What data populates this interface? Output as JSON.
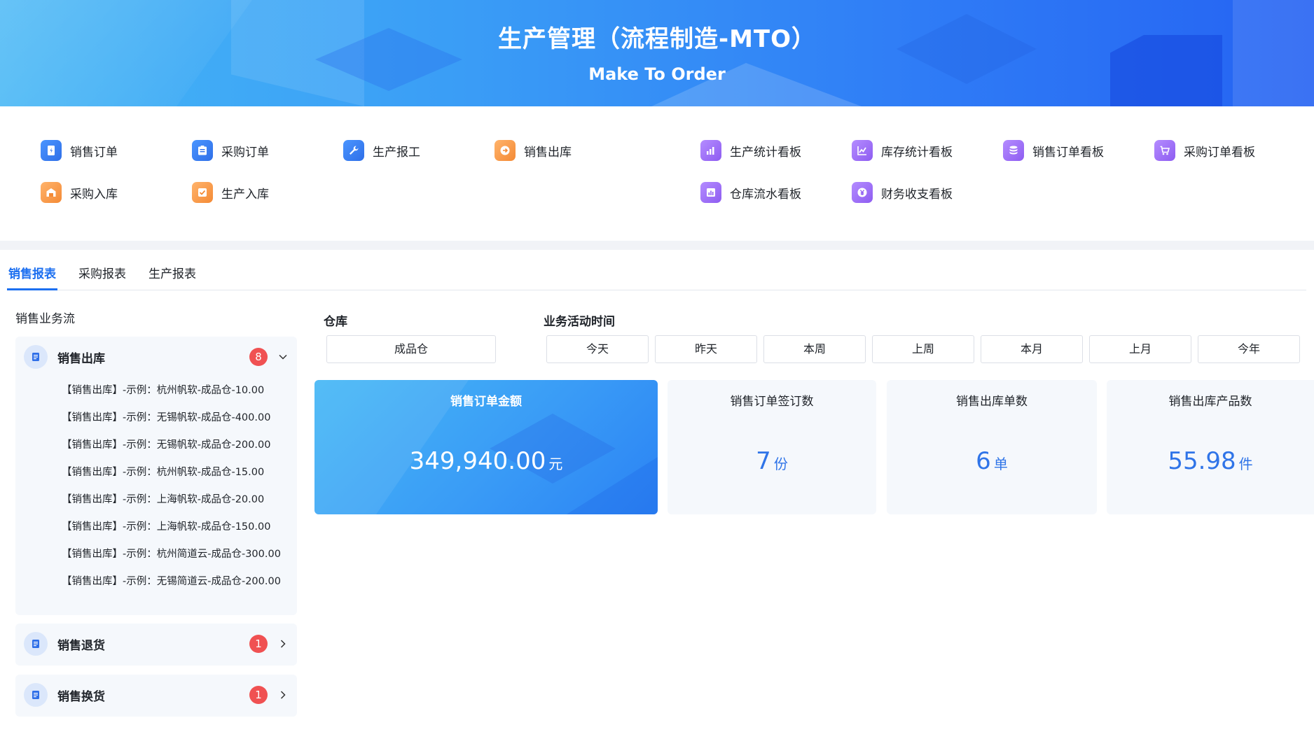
{
  "banner": {
    "title": "生产管理（流程制造-MTO）",
    "subtitle": "Make To Order"
  },
  "quick_links": [
    {
      "label": "销售订单",
      "icon": "sales-order-icon",
      "color": "blue"
    },
    {
      "label": "采购订单",
      "icon": "purchase-order-icon",
      "color": "blue"
    },
    {
      "label": "生产报工",
      "icon": "wrench-icon",
      "color": "blue"
    },
    {
      "label": "销售出库",
      "icon": "arrow-circle-icon",
      "color": "orange"
    },
    {
      "label": "采购入库",
      "icon": "warehouse-in-icon",
      "color": "orange"
    },
    {
      "label": "生产入库",
      "icon": "check-box-icon",
      "color": "orange"
    },
    {
      "label": "生产统计看板",
      "icon": "bar-chart-icon",
      "color": "purple"
    },
    {
      "label": "库存统计看板",
      "icon": "line-chart-icon",
      "color": "purple"
    },
    {
      "label": "销售订单看板",
      "icon": "database-icon",
      "color": "purple"
    },
    {
      "label": "采购订单看板",
      "icon": "cart-icon",
      "color": "purple"
    },
    {
      "label": "仓库流水看板",
      "icon": "bar-board-icon",
      "color": "purple"
    },
    {
      "label": "财务收支看板",
      "icon": "yen-icon",
      "color": "purple"
    }
  ],
  "tabs": [
    {
      "label": "销售报表",
      "active": true
    },
    {
      "label": "采购报表",
      "active": false
    },
    {
      "label": "生产报表",
      "active": false
    }
  ],
  "flow": {
    "title": "销售业务流",
    "groups": [
      {
        "name": "销售出库",
        "count": "8",
        "expanded": true,
        "items": [
          "【销售出库】-示例：杭州帆软-成品仓-10.00",
          "【销售出库】-示例：无锡帆软-成品仓-400.00",
          "【销售出库】-示例：无锡帆软-成品仓-200.00",
          "【销售出库】-示例：杭州帆软-成品仓-15.00",
          "【销售出库】-示例：上海帆软-成品仓-20.00",
          "【销售出库】-示例：上海帆软-成品仓-150.00",
          "【销售出库】-示例：杭州简道云-成品仓-300.00",
          "【销售出库】-示例：无锡简道云-成品仓-200.00"
        ]
      },
      {
        "name": "销售退货",
        "count": "1",
        "expanded": false
      },
      {
        "name": "销售换货",
        "count": "1",
        "expanded": false
      }
    ]
  },
  "filters": {
    "warehouse_label": "仓库",
    "warehouse_value": "成品仓",
    "time_label": "业务活动时间",
    "time_options": [
      "今天",
      "昨天",
      "本周",
      "上周",
      "本月",
      "上月",
      "今年"
    ]
  },
  "stats": [
    {
      "title": "销售订单金额",
      "value": "349,940.00",
      "unit": "元"
    },
    {
      "title": "销售订单签订数",
      "value": "7",
      "unit": "份"
    },
    {
      "title": "销售出库单数",
      "value": "6",
      "unit": "单"
    },
    {
      "title": "销售出库产品数",
      "value": "55.98",
      "unit": "件"
    }
  ],
  "colors": {
    "accent": "#1c6ff0",
    "badge": "#f05152",
    "stat_value": "#2f74e8"
  }
}
